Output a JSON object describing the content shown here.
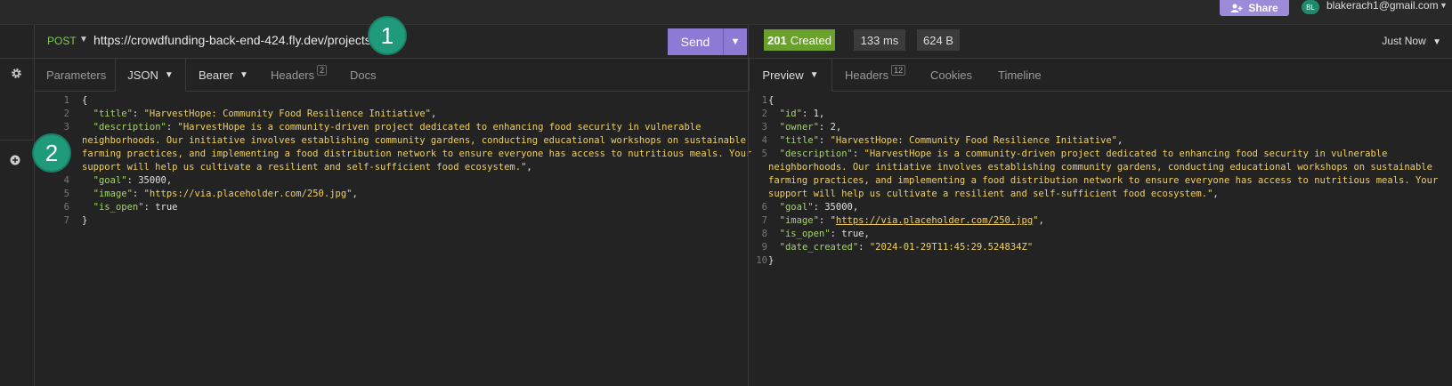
{
  "topbar": {
    "share_label": "Share",
    "avatar_initials": "BL",
    "user_email": "blakerach1@gmail.com"
  },
  "request": {
    "method": "POST",
    "url": "https://crowdfunding-back-end-424.fly.dev/projects/",
    "send_label": "Send",
    "tabs": {
      "parameters": "Parameters",
      "json": "JSON",
      "bearer": "Bearer",
      "headers": "Headers",
      "headers_count": "2",
      "docs": "Docs"
    },
    "body_lines": [
      {
        "n": "1",
        "t": [
          [
            "p",
            "{"
          ]
        ]
      },
      {
        "n": "2",
        "t": [
          [
            "p",
            "  "
          ],
          [
            "k",
            "\"title\""
          ],
          [
            "p",
            ": "
          ],
          [
            "s",
            "\"HarvestHope: Community Food Resilience Initiative\""
          ],
          [
            "p",
            ","
          ]
        ]
      },
      {
        "n": "3",
        "t": [
          [
            "p",
            "  "
          ],
          [
            "k",
            "\"description\""
          ],
          [
            "p",
            ": "
          ],
          [
            "s",
            "\"HarvestHope is a community-driven project dedicated to enhancing food security in vulnerable"
          ]
        ]
      },
      {
        "n": "",
        "t": [
          [
            "s",
            "neighborhoods. Our initiative involves establishing community gardens, conducting educational workshops on sustainable"
          ]
        ]
      },
      {
        "n": "",
        "t": [
          [
            "s",
            "farming practices, and implementing a food distribution network to ensure everyone has access to nutritious meals. Your"
          ]
        ]
      },
      {
        "n": "",
        "t": [
          [
            "s",
            "support will help us cultivate a resilient and self-sufficient food ecosystem.\""
          ],
          [
            "p",
            ","
          ]
        ]
      },
      {
        "n": "4",
        "t": [
          [
            "p",
            "  "
          ],
          [
            "k",
            "\"goal\""
          ],
          [
            "p",
            ": 35000,"
          ]
        ]
      },
      {
        "n": "5",
        "t": [
          [
            "p",
            "  "
          ],
          [
            "k",
            "\"image\""
          ],
          [
            "p",
            ": "
          ],
          [
            "s",
            "\"https://via.placeholder.com/250.jpg\""
          ],
          [
            "p",
            ","
          ]
        ]
      },
      {
        "n": "6",
        "t": [
          [
            "p",
            "  "
          ],
          [
            "k",
            "\"is_open\""
          ],
          [
            "p",
            ": true"
          ]
        ]
      },
      {
        "n": "7",
        "t": [
          [
            "p",
            "}"
          ]
        ]
      }
    ]
  },
  "annotations": {
    "badge1": "1",
    "badge2": "2"
  },
  "response": {
    "status_code": "201",
    "status_text": "Created",
    "time": "133 ms",
    "size": "624 B",
    "when": "Just Now",
    "tabs": {
      "preview": "Preview",
      "headers": "Headers",
      "headers_count": "12",
      "cookies": "Cookies",
      "timeline": "Timeline"
    },
    "body_lines": [
      {
        "n": "1",
        "t": [
          [
            "p",
            "{"
          ]
        ]
      },
      {
        "n": "2",
        "t": [
          [
            "p",
            "  "
          ],
          [
            "k",
            "\"id\""
          ],
          [
            "p",
            ": 1,"
          ]
        ]
      },
      {
        "n": "3",
        "t": [
          [
            "p",
            "  "
          ],
          [
            "k",
            "\"owner\""
          ],
          [
            "p",
            ": 2,"
          ]
        ]
      },
      {
        "n": "4",
        "t": [
          [
            "p",
            "  "
          ],
          [
            "k",
            "\"title\""
          ],
          [
            "p",
            ": "
          ],
          [
            "s",
            "\"HarvestHope: Community Food Resilience Initiative\""
          ],
          [
            "p",
            ","
          ]
        ]
      },
      {
        "n": "5",
        "t": [
          [
            "p",
            "  "
          ],
          [
            "k",
            "\"description\""
          ],
          [
            "p",
            ": "
          ],
          [
            "s",
            "\"HarvestHope is a community-driven project dedicated to enhancing food security in vulnerable"
          ]
        ]
      },
      {
        "n": "",
        "t": [
          [
            "s",
            "neighborhoods. Our initiative involves establishing community gardens, conducting educational workshops on sustainable"
          ]
        ]
      },
      {
        "n": "",
        "t": [
          [
            "s",
            "farming practices, and implementing a food distribution network to ensure everyone has access to nutritious meals. Your"
          ]
        ]
      },
      {
        "n": "",
        "t": [
          [
            "s",
            "support will help us cultivate a resilient and self-sufficient food ecosystem.\""
          ],
          [
            "p",
            ","
          ]
        ]
      },
      {
        "n": "6",
        "t": [
          [
            "p",
            "  "
          ],
          [
            "k",
            "\"goal\""
          ],
          [
            "p",
            ": 35000,"
          ]
        ]
      },
      {
        "n": "7",
        "t": [
          [
            "p",
            "  "
          ],
          [
            "k",
            "\"image\""
          ],
          [
            "p",
            ": \""
          ],
          [
            "u",
            "https://via.placeholder.com/250.jpg"
          ],
          [
            "s",
            "\""
          ],
          [
            "p",
            ","
          ]
        ]
      },
      {
        "n": "8",
        "t": [
          [
            "p",
            "  "
          ],
          [
            "k",
            "\"is_open\""
          ],
          [
            "p",
            ": true,"
          ]
        ]
      },
      {
        "n": "9",
        "t": [
          [
            "p",
            "  "
          ],
          [
            "k",
            "\"date_created\""
          ],
          [
            "p",
            ": "
          ],
          [
            "s",
            "\"2024-01-29T11:45:29.524834Z\""
          ]
        ]
      },
      {
        "n": "10",
        "t": [
          [
            "p",
            "}"
          ]
        ]
      }
    ]
  },
  "icons": {
    "settings": "gear-icon",
    "add": "plus-circle-icon"
  }
}
